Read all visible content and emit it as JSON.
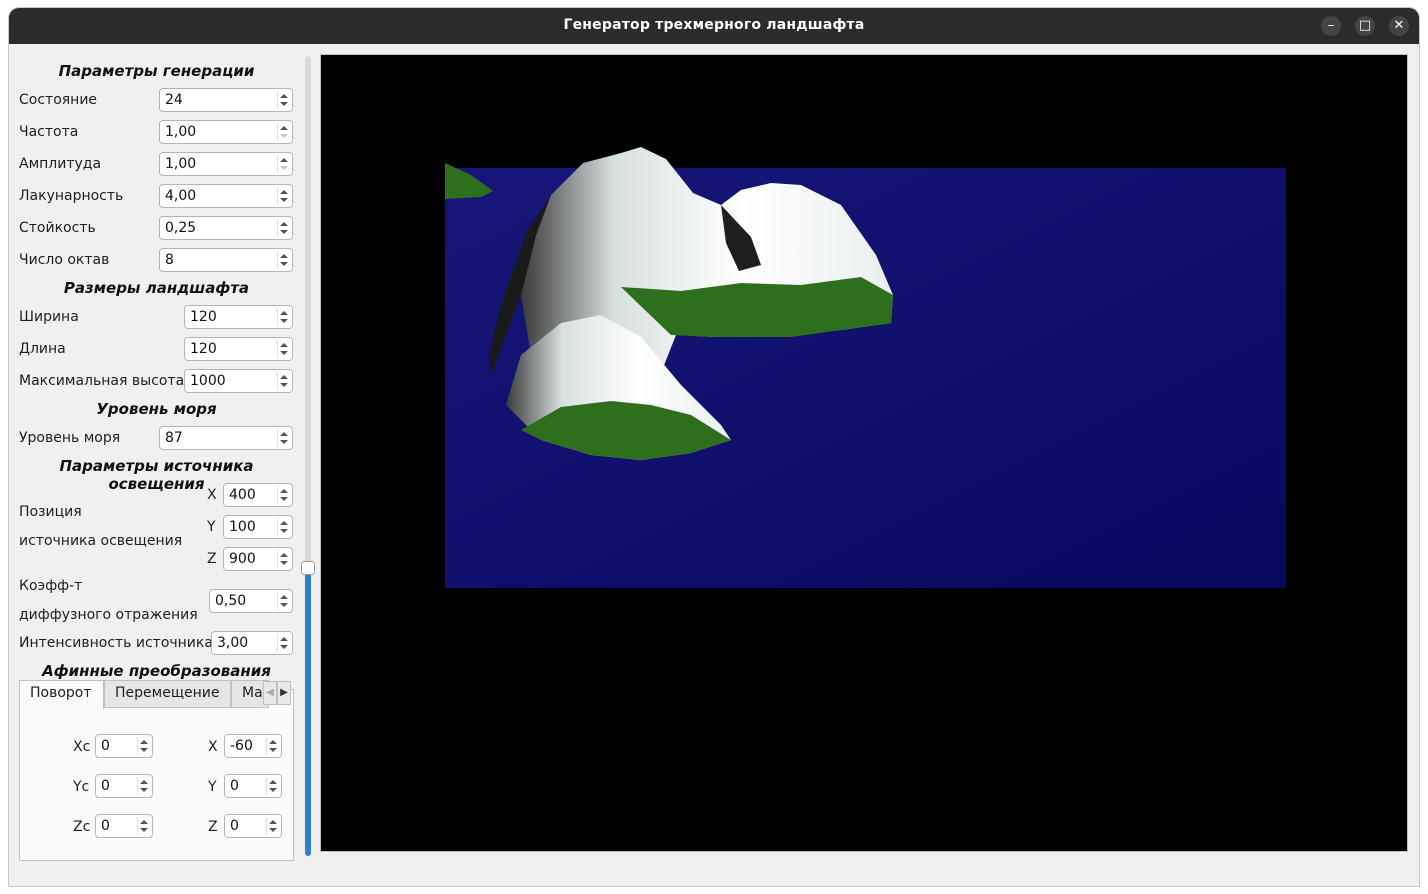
{
  "window": {
    "title": "Генератор трехмерного ландшафта"
  },
  "titlebar_buttons": {
    "minimize": "–",
    "maximize": "□",
    "close": "✕"
  },
  "generation": {
    "header": "Параметры генерации",
    "state": {
      "label": "Состояние",
      "value": "24"
    },
    "frequency": {
      "label": "Частота",
      "value": "1,00"
    },
    "amplitude": {
      "label": "Амплитуда",
      "value": "1,00"
    },
    "lacunarity": {
      "label": "Лакунарность",
      "value": "4,00"
    },
    "persistence": {
      "label": "Стойкость",
      "value": "0,25"
    },
    "octaves": {
      "label": "Число октав",
      "value": "8"
    }
  },
  "size": {
    "header": "Размеры ландшафта",
    "width": {
      "label": "Ширина",
      "value": "120"
    },
    "length": {
      "label": "Длина",
      "value": "120"
    },
    "max_height": {
      "label": "Максимальная высота",
      "value": "1000"
    }
  },
  "sea": {
    "header": "Уровень моря",
    "level": {
      "label": "Уровень моря",
      "value": "87"
    }
  },
  "light": {
    "header": "Параметры источника освещения",
    "position_label_1": "Позиция",
    "position_label_2": "источника освещения",
    "x": {
      "label": "X",
      "value": "400"
    },
    "y": {
      "label": "Y",
      "value": "100"
    },
    "z": {
      "label": "Z",
      "value": "900"
    },
    "diffuse_label_1": "Коэфф-т",
    "diffuse_label_2": "диффузного отражения",
    "diffuse_value": "0,50",
    "intensity": {
      "label": "Интенсивность источника",
      "value": "3,00"
    }
  },
  "affine": {
    "header": "Афинные преобразования",
    "tabs": [
      "Поворот",
      "Перемещение",
      "Ма"
    ],
    "xc": {
      "label": "Xc",
      "value": "0"
    },
    "yc": {
      "label": "Yc",
      "value": "0"
    },
    "zc": {
      "label": "Zc",
      "value": "0"
    },
    "x": {
      "label": "X",
      "value": "-60"
    },
    "y": {
      "label": "Y",
      "value": "0"
    },
    "z": {
      "label": "Z",
      "value": "0"
    }
  },
  "scene": {
    "background": "#000000",
    "sea_color": "#0d0d6e",
    "snow_color": "#f4f8f8",
    "grass_color": "#2e6f1e"
  }
}
